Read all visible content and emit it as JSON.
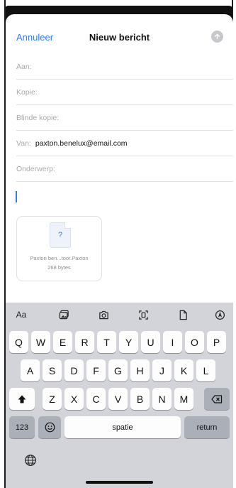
{
  "compose": {
    "cancel_label": "Annuleer",
    "title": "Nieuw bericht",
    "send_icon": "arrow-up-circle-icon"
  },
  "fields": {
    "to_label": "Aan:",
    "cc_label": "Kopie:",
    "bcc_label": "Blinde kopie:",
    "from_label": "Van:",
    "from_value": "paxton.benelux@email.com",
    "subject_label": "Onderwerp:"
  },
  "attachment": {
    "icon_glyph": "?",
    "name": "Paxton ben...toor.Paxton",
    "size": "268 bytes"
  },
  "keyboard_toolbar": {
    "format_label": "Aa",
    "icons": [
      "photo-library-icon",
      "camera-icon",
      "scan-document-icon",
      "file-icon",
      "markup-icon"
    ]
  },
  "keyboard": {
    "row1": [
      "Q",
      "W",
      "E",
      "R",
      "T",
      "Y",
      "U",
      "I",
      "O",
      "P"
    ],
    "row2": [
      "A",
      "S",
      "D",
      "F",
      "G",
      "H",
      "J",
      "K",
      "L"
    ],
    "row3": [
      "Z",
      "X",
      "C",
      "V",
      "B",
      "N",
      "M"
    ],
    "numbers_label": "123",
    "space_label": "spatie",
    "return_label": "return",
    "shift_icon": "shift-icon",
    "delete_icon": "backspace-icon",
    "emoji_icon": "emoji-icon",
    "globe_icon": "globe-icon"
  },
  "colors": {
    "accent": "#2f7bf6",
    "keyboard_bg": "#d3d4d9"
  }
}
